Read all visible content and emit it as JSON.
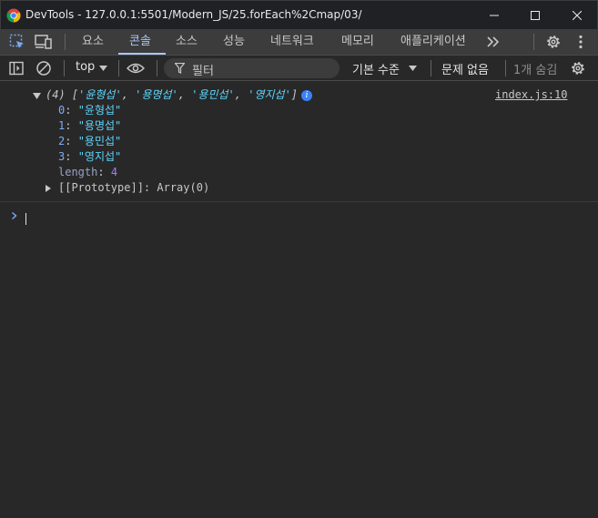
{
  "window": {
    "title": "DevTools - 127.0.0.1:5501/Modern_JS/25.forEach%2Cmap/03/"
  },
  "tabs": [
    {
      "label": "요소",
      "active": false
    },
    {
      "label": "콘솔",
      "active": true
    },
    {
      "label": "소스",
      "active": false
    },
    {
      "label": "성능",
      "active": false
    },
    {
      "label": "네트워크",
      "active": false
    },
    {
      "label": "메모리",
      "active": false
    },
    {
      "label": "애플리케이션",
      "active": false
    }
  ],
  "toolbar": {
    "context": "top",
    "filter_placeholder": "필터",
    "log_level": "기본 수준",
    "issues": "문제 없음",
    "hidden": "1개 숨김"
  },
  "console": {
    "array_summary": {
      "prefix": "(4) [",
      "items": [
        "'윤형섭'",
        "'용명섭'",
        "'용민섭'",
        "'영지섭'"
      ],
      "separator": ", ",
      "suffix": "]"
    },
    "source_link": "index.js:10",
    "entries": [
      {
        "key": "0",
        "value": "\"윤형섭\""
      },
      {
        "key": "1",
        "value": "\"용명섭\""
      },
      {
        "key": "2",
        "value": "\"용민섭\""
      },
      {
        "key": "3",
        "value": "\"영지섭\""
      }
    ],
    "length_key": "length",
    "length_value": "4",
    "prototype_label": "[[Prototype]]",
    "prototype_value": "Array(0)"
  },
  "colors": {
    "background": "#282828",
    "string": "#5cd5fb",
    "key": "#7cacf8",
    "number": "#9980ff",
    "active_tab": "#a8c7fa"
  }
}
